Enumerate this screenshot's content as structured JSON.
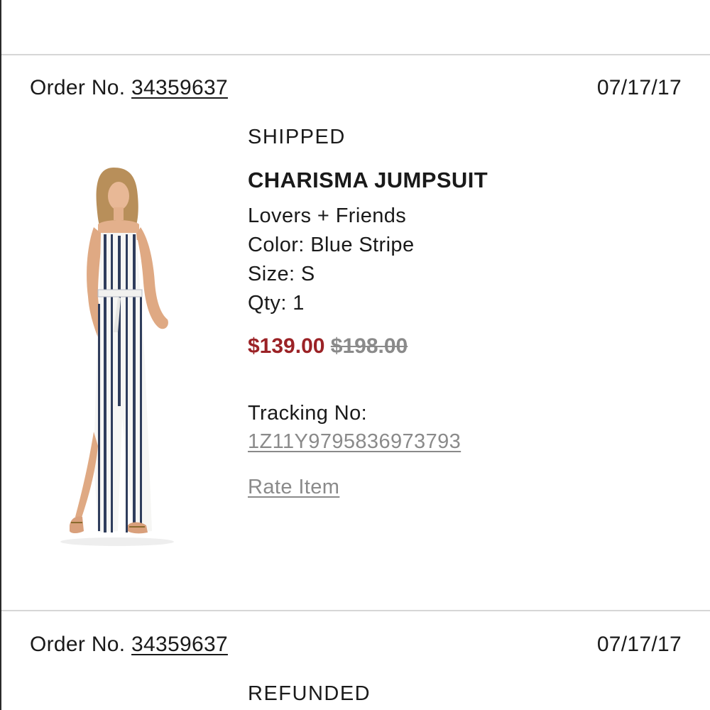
{
  "orders": [
    {
      "order_label": "Order No.",
      "order_number": "34359637",
      "date": "07/17/17",
      "status": "SHIPPED",
      "item": {
        "name": "CHARISMA JUMPSUIT",
        "brand": "Lovers + Friends",
        "color": "Color: Blue Stripe",
        "size": "Size: S",
        "qty": "Qty: 1",
        "sale_price": "$139.00",
        "original_price": "$198.00",
        "image_icon": "product-photo-striped-jumpsuit"
      },
      "tracking_label": "Tracking No:",
      "tracking_number": "1Z11Y9795836973793",
      "rate_label": "Rate Item"
    },
    {
      "order_label": "Order No.",
      "order_number": "34359637",
      "date": "07/17/17",
      "status": "REFUNDED"
    }
  ],
  "colors": {
    "sale_price": "#9b2226",
    "muted_link": "#8a8a8a",
    "divider": "#d6d6d6"
  }
}
